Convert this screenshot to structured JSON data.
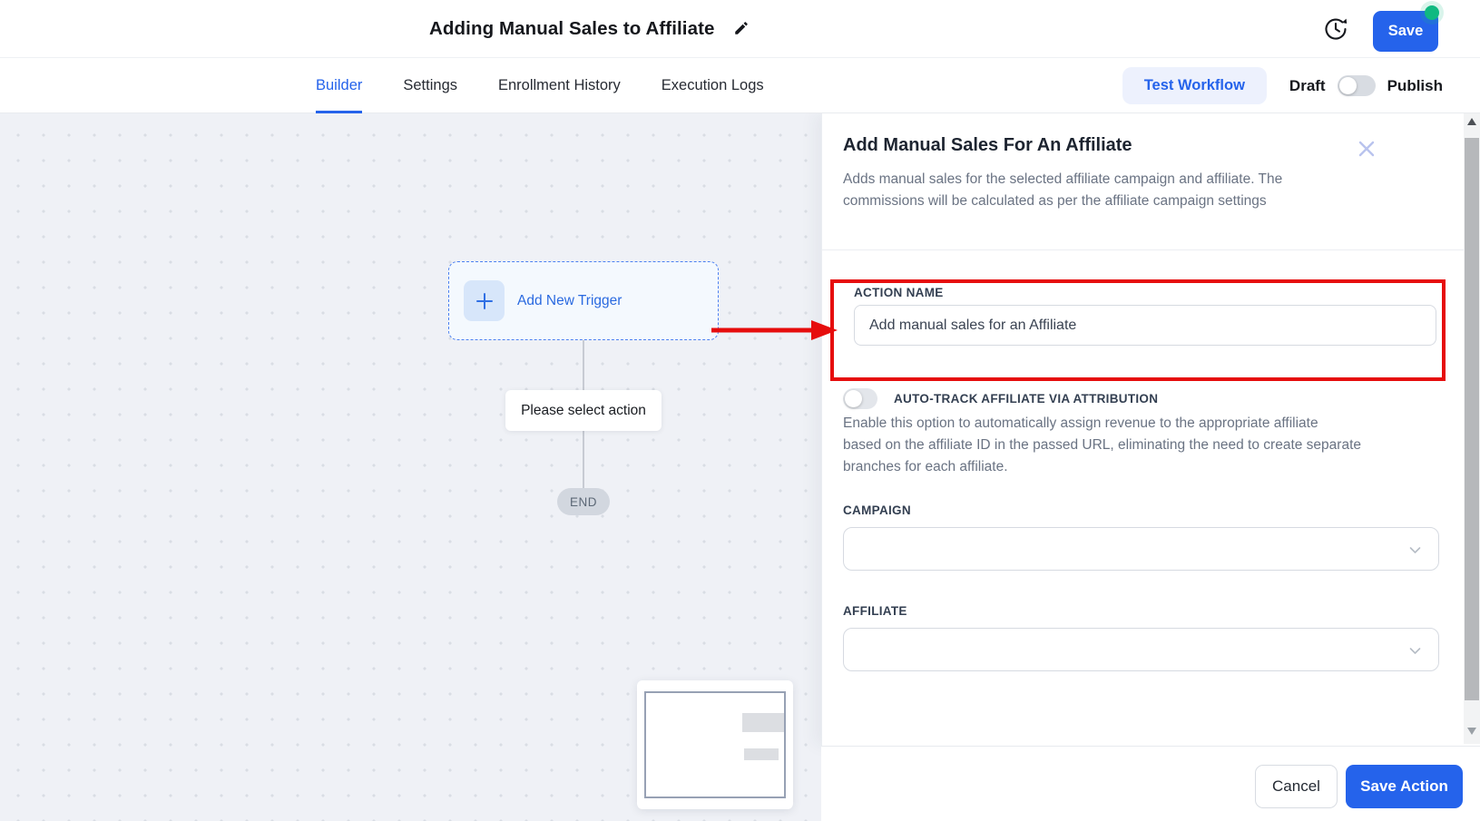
{
  "header": {
    "title": "Adding Manual Sales to Affiliate",
    "save_button": "Save",
    "has_unsaved_changes_dot": true
  },
  "tabs": {
    "items": [
      {
        "label": "Builder",
        "active": true
      },
      {
        "label": "Settings",
        "active": false
      },
      {
        "label": "Enrollment History",
        "active": false
      },
      {
        "label": "Execution Logs",
        "active": false
      }
    ],
    "test_workflow_button": "Test Workflow",
    "draft_label": "Draft",
    "publish_label": "Publish",
    "publish_toggle_state": "off"
  },
  "canvas": {
    "trigger_node_label": "Add New Trigger",
    "hint_label": "Please select action",
    "end_label": "END"
  },
  "panel": {
    "title": "Add Manual Sales For An Affiliate",
    "description_lines": [
      "Adds manual sales for the selected affiliate campaign and affiliate. The",
      "commissions will be calculated as per the affiliate campaign settings"
    ],
    "action_name": {
      "label": "ACTION NAME",
      "value": "Add manual sales for an Affiliate"
    },
    "auto_track": {
      "label": "AUTO-TRACK AFFILIATE VIA ATTRIBUTION",
      "toggle_state": "off",
      "description_lines": [
        "Enable this option to automatically assign revenue to the appropriate affiliate",
        "based on the affiliate ID in the passed URL, eliminating the need to create separate",
        "branches for each affiliate."
      ]
    },
    "campaign": {
      "label": "CAMPAIGN",
      "value": ""
    },
    "affiliate": {
      "label": "AFFILIATE",
      "value": ""
    },
    "footer": {
      "cancel_button": "Cancel",
      "save_button": "Save Action"
    }
  },
  "icons": {
    "edit": "pencil-icon",
    "history": "clock-history-icon",
    "close": "x-icon",
    "add": "plus-icon",
    "dropdown": "chevron-down-icon"
  },
  "colors": {
    "primary_blue": "#2563eb",
    "annotation_red": "#e60d0d",
    "success_green": "#10b981",
    "canvas_background": "#eff1f6"
  }
}
